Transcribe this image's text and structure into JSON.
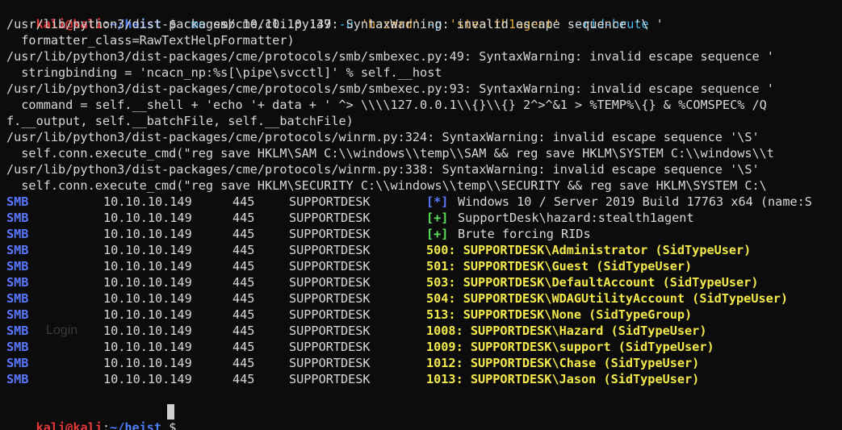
{
  "prompt": {
    "user": "kali",
    "at": "@",
    "host": "kali",
    "colon": ":",
    "path": "~/heist",
    "symbol": "$"
  },
  "command": {
    "program": "cme",
    "args_1": " smb 10.10.10.149 ",
    "flag_u": "-u",
    "user": "'hazard'",
    "flag_p": "-p",
    "pass": "'stealth1agent'",
    "flag_rid": "--rid-brute"
  },
  "warnings": [
    "/usr/lib/python3/dist-packages/cme/cli.py:37: SyntaxWarning: invalid escape sequence '\\ '",
    "  formatter_class=RawTextHelpFormatter)",
    "/usr/lib/python3/dist-packages/cme/protocols/smb/smbexec.py:49: SyntaxWarning: invalid escape sequence '",
    "  stringbinding = 'ncacn_np:%s[\\pipe\\svcctl]' % self.__host",
    "/usr/lib/python3/dist-packages/cme/protocols/smb/smbexec.py:93: SyntaxWarning: invalid escape sequence '",
    "  command = self.__shell + 'echo '+ data + ' ^> \\\\\\\\127.0.0.1\\\\{}\\\\{} 2^>^&1 > %TEMP%\\{} & %COMSPEC% /Q",
    "f.__output, self.__batchFile, self.__batchFile)",
    "/usr/lib/python3/dist-packages/cme/protocols/winrm.py:324: SyntaxWarning: invalid escape sequence '\\S'",
    "  self.conn.execute_cmd(\"reg save HKLM\\SAM C:\\\\windows\\\\temp\\\\SAM && reg save HKLM\\SYSTEM C:\\\\windows\\\\t",
    "/usr/lib/python3/dist-packages/cme/protocols/winrm.py:338: SyntaxWarning: invalid escape sequence '\\S'",
    "  self.conn.execute_cmd(\"reg save HKLM\\SECURITY C:\\\\windows\\\\temp\\\\SECURITY && reg save HKLM\\SYSTEM C:\\"
  ],
  "results": [
    {
      "proto": "SMB",
      "ip": "10.10.10.149",
      "port": "445",
      "host": "SUPPORTDESK",
      "bracket": "[*]",
      "bracket_color": "blue",
      "text": "Windows 10 / Server 2019 Build 17763 x64 (name:S",
      "style": "plain"
    },
    {
      "proto": "SMB",
      "ip": "10.10.10.149",
      "port": "445",
      "host": "SUPPORTDESK",
      "bracket": "[+]",
      "bracket_color": "green",
      "text": "SupportDesk\\hazard:stealth1agent",
      "style": "plain"
    },
    {
      "proto": "SMB",
      "ip": "10.10.10.149",
      "port": "445",
      "host": "SUPPORTDESK",
      "bracket": "[+]",
      "bracket_color": "green",
      "text": "Brute forcing RIDs",
      "style": "plain"
    },
    {
      "proto": "SMB",
      "ip": "10.10.10.149",
      "port": "445",
      "host": "SUPPORTDESK",
      "bracket": "",
      "bracket_color": "",
      "text": "500: SUPPORTDESK\\Administrator (SidTypeUser)",
      "style": "yellow"
    },
    {
      "proto": "SMB",
      "ip": "10.10.10.149",
      "port": "445",
      "host": "SUPPORTDESK",
      "bracket": "",
      "bracket_color": "",
      "text": "501: SUPPORTDESK\\Guest (SidTypeUser)",
      "style": "yellow"
    },
    {
      "proto": "SMB",
      "ip": "10.10.10.149",
      "port": "445",
      "host": "SUPPORTDESK",
      "bracket": "",
      "bracket_color": "",
      "text": "503: SUPPORTDESK\\DefaultAccount (SidTypeUser)",
      "style": "yellow"
    },
    {
      "proto": "SMB",
      "ip": "10.10.10.149",
      "port": "445",
      "host": "SUPPORTDESK",
      "bracket": "",
      "bracket_color": "",
      "text": "504: SUPPORTDESK\\WDAGUtilityAccount (SidTypeUser)",
      "style": "yellow"
    },
    {
      "proto": "SMB",
      "ip": "10.10.10.149",
      "port": "445",
      "host": "SUPPORTDESK",
      "bracket": "",
      "bracket_color": "",
      "text": "513: SUPPORTDESK\\None (SidTypeGroup)",
      "style": "yellow"
    },
    {
      "proto": "SMB",
      "ip": "10.10.10.149",
      "port": "445",
      "host": "SUPPORTDESK",
      "bracket": "",
      "bracket_color": "",
      "text": "1008: SUPPORTDESK\\Hazard (SidTypeUser)",
      "style": "yellow"
    },
    {
      "proto": "SMB",
      "ip": "10.10.10.149",
      "port": "445",
      "host": "SUPPORTDESK",
      "bracket": "",
      "bracket_color": "",
      "text": "1009: SUPPORTDESK\\support (SidTypeUser)",
      "style": "yellow"
    },
    {
      "proto": "SMB",
      "ip": "10.10.10.149",
      "port": "445",
      "host": "SUPPORTDESK",
      "bracket": "",
      "bracket_color": "",
      "text": "1012: SUPPORTDESK\\Chase (SidTypeUser)",
      "style": "yellow"
    },
    {
      "proto": "SMB",
      "ip": "10.10.10.149",
      "port": "445",
      "host": "SUPPORTDESK",
      "bracket": "",
      "bracket_color": "",
      "text": "1013: SUPPORTDESK\\Jason (SidTypeUser)",
      "style": "yellow"
    }
  ],
  "background_ghost": {
    "login": "Login"
  },
  "colors": {
    "background": "#0c0c0c",
    "prompt_user": "#e5383b",
    "prompt_path": "#4f7ff5",
    "smb_label": "#5a78ff",
    "success": "#5ce05c",
    "rid_text": "#f4ea4c"
  }
}
